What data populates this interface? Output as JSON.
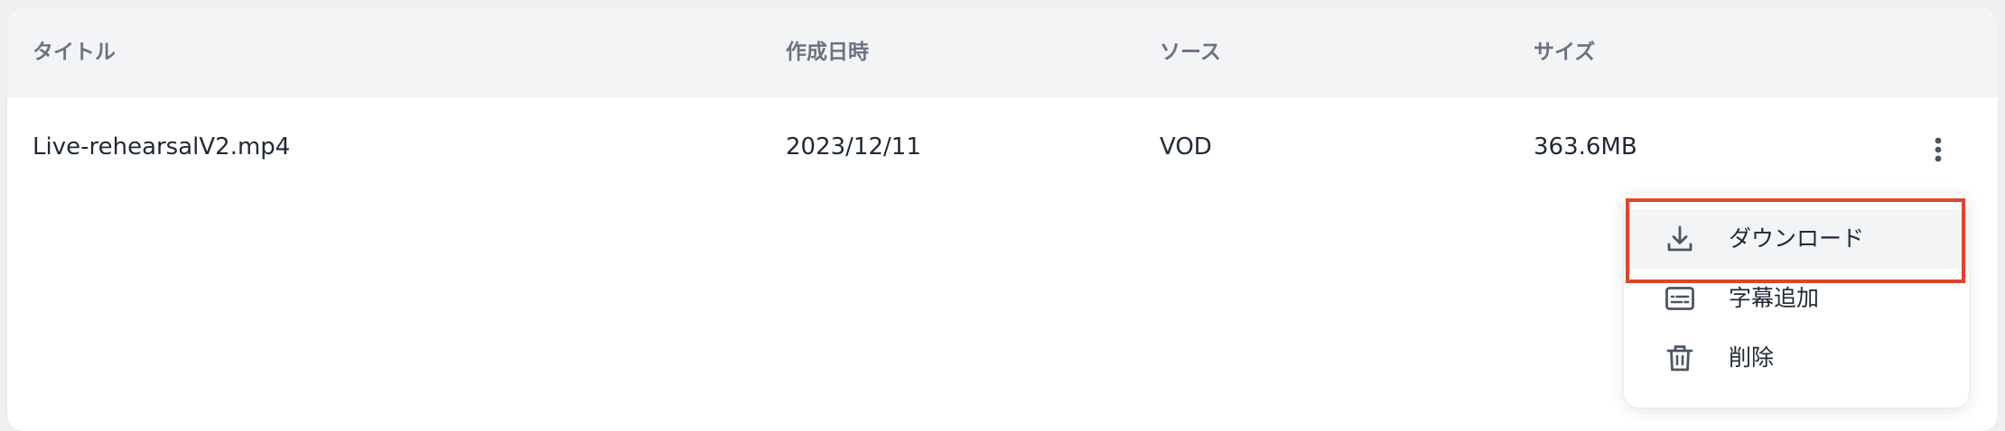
{
  "table": {
    "columns": [
      "タイトル",
      "作成日時",
      "ソース",
      "サイズ"
    ],
    "rows": [
      {
        "title": "Live-rehearsalV2.mp4",
        "created": "2023/12/11",
        "source": "VOD",
        "size": "363.6MB"
      }
    ]
  },
  "row_menu": {
    "items": [
      {
        "label": "ダウンロード",
        "icon": "download-icon"
      },
      {
        "label": "字幕追加",
        "icon": "subtitles-icon"
      },
      {
        "label": "削除",
        "icon": "trash-icon"
      }
    ],
    "highlighted_item": "ダウンロード"
  },
  "colors": {
    "header_bg": "#f3f4f6",
    "header_text": "#6b7280",
    "body_text": "#1f2937",
    "icon": "#4b5563",
    "highlight_border": "#e0452b"
  }
}
